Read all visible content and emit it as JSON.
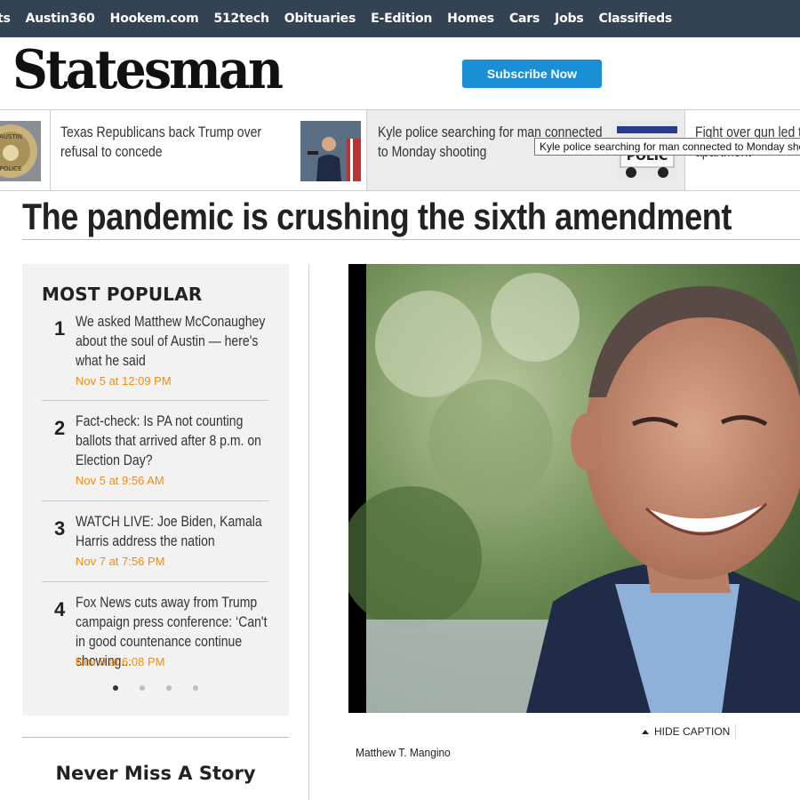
{
  "topnav": {
    "items": [
      "ts",
      "Austin360",
      "Hookem.com",
      "512tech",
      "Obituaries",
      "E-Edition",
      "Homes",
      "Cars",
      "Jobs",
      "Classifieds"
    ]
  },
  "header": {
    "logo": "Statesman",
    "subscribe_label": "Subscribe Now"
  },
  "strip": {
    "items": [
      {
        "title": "Texas Republicans back Trump over refusal to concede"
      },
      {
        "title": "Kyle police searching for man connected to Monday shooting"
      },
      {
        "title": "Fight over gun led to South Austin apartment"
      }
    ],
    "tooltip": "Kyle police searching for man connected to Monday shooting"
  },
  "article": {
    "title": "The pandemic is crushing the sixth amendment",
    "caption_toggle": "HIDE CAPTION",
    "caption": "Matthew T. Mangino"
  },
  "popular": {
    "heading": "MOST POPULAR",
    "items": [
      {
        "num": "1",
        "title": "We asked Matthew McConaughey about the soul of Austin — here's what he said",
        "date": "Nov 5 at 12:09 PM"
      },
      {
        "num": "2",
        "title": "Fact-check: Is PA not counting ballots that arrived after 8 p.m. on Election Day?",
        "date": "Nov 5 at 9:56 AM"
      },
      {
        "num": "3",
        "title": "WATCH LIVE: Joe Biden, Kamala Harris address the nation",
        "date": "Nov 7 at 7:56 PM"
      },
      {
        "num": "4",
        "title": "Fox News cuts away from Trump campaign press conference: ‘Can't in good countenance continue showing...",
        "date": "Nov 9 at 6:08 PM"
      }
    ]
  },
  "newsletter": {
    "heading": "Never Miss A Story"
  },
  "colors": {
    "nav_bg": "#344353",
    "subscribe_bg": "#1a8fd6",
    "date_color": "#ef8c14"
  }
}
